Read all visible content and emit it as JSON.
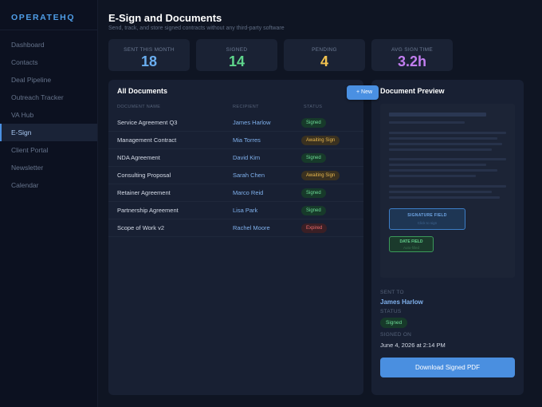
{
  "sidebar": {
    "brand": "OPERATEHQ",
    "items": [
      {
        "label": "Dashboard"
      },
      {
        "label": "Contacts"
      },
      {
        "label": "Deal Pipeline"
      },
      {
        "label": "Outreach Tracker"
      },
      {
        "label": "VA Hub"
      },
      {
        "label": "E-Sign",
        "active": true
      },
      {
        "label": "Client Portal"
      },
      {
        "label": "Newsletter"
      },
      {
        "label": "Calendar"
      }
    ]
  },
  "header": {
    "title": "E-Sign and Documents",
    "subtitle": "Send, track, and store signed contracts without any third-party software"
  },
  "stats": [
    {
      "label": "SENT THIS MONTH",
      "value": "18",
      "color": "#6aaef0"
    },
    {
      "label": "SIGNED",
      "value": "14",
      "color": "#5fd68c"
    },
    {
      "label": "PENDING",
      "value": "4",
      "color": "#f1c24f"
    },
    {
      "label": "AVG SIGN TIME",
      "value": "3.2h",
      "color": "#c27ef0"
    }
  ],
  "documents": {
    "title": "All Documents",
    "new_button": "+ New",
    "columns": [
      "DOCUMENT NAME",
      "RECIPIENT",
      "STATUS"
    ],
    "rows": [
      {
        "name": "Service Agreement Q3",
        "recipient": "James Harlow",
        "status": "Signed"
      },
      {
        "name": "Management Contract",
        "recipient": "Mia Torres",
        "status": "Awaiting Sign"
      },
      {
        "name": "NDA Agreement",
        "recipient": "David Kim",
        "status": "Signed"
      },
      {
        "name": "Consulting Proposal",
        "recipient": "Sarah Chen",
        "status": "Awaiting Sign"
      },
      {
        "name": "Retainer Agreement",
        "recipient": "Marco Reid",
        "status": "Signed"
      },
      {
        "name": "Partnership Agreement",
        "recipient": "Lisa Park",
        "status": "Signed"
      },
      {
        "name": "Scope of Work v2",
        "recipient": "Rachel Moore",
        "status": "Expired"
      }
    ]
  },
  "status_colors": {
    "Signed": {
      "bg": "#173a2a",
      "fg": "#6ddb97"
    },
    "Awaiting Sign": {
      "bg": "#3a3120",
      "fg": "#e8b84e"
    },
    "Expired": {
      "bg": "#3a1f25",
      "fg": "#ec6b6b"
    }
  },
  "preview": {
    "title": "Document Preview",
    "signature_field": "SIGNATURE FIELD",
    "signature_hint": "Click to sign",
    "date_field": "DATE FIELD",
    "date_hint": "Auto-filled",
    "sent_to_label": "SENT TO",
    "sent_to": "James Harlow",
    "status_label": "STATUS",
    "status": "Signed",
    "signed_on_label": "SIGNED ON",
    "signed_on": "June 4, 2026 at 2:14 PM",
    "download_label": "Download Signed PDF"
  }
}
